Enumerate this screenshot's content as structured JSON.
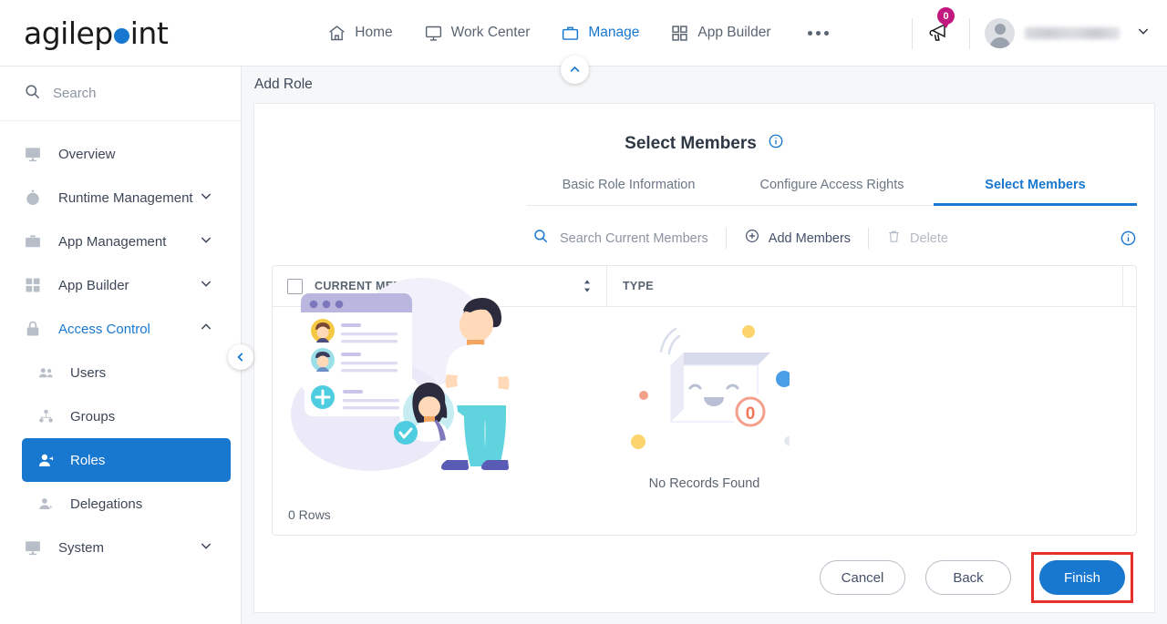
{
  "brand": {
    "name_start": "agilep",
    "name_end": "int",
    "dot_color": "#1878d0"
  },
  "topnav": {
    "items": [
      {
        "label": "Home",
        "icon": "home-icon",
        "active": false
      },
      {
        "label": "Work Center",
        "icon": "monitor-icon",
        "active": false
      },
      {
        "label": "Manage",
        "icon": "briefcase-icon",
        "active": true
      },
      {
        "label": "App Builder",
        "icon": "grid-icon",
        "active": false
      }
    ],
    "more_label": "more-options",
    "notification_count": "0",
    "user_name": ""
  },
  "sidebar": {
    "search_placeholder": "Search",
    "items": [
      {
        "label": "Overview",
        "icon": "chart-monitor-icon",
        "expandable": false,
        "active": false
      },
      {
        "label": "Runtime Management",
        "icon": "stopwatch-icon",
        "expandable": true,
        "active": false
      },
      {
        "label": "App Management",
        "icon": "briefcase-icon",
        "expandable": true,
        "active": false
      },
      {
        "label": "App Builder",
        "icon": "grid-check-icon",
        "expandable": true,
        "active": false
      },
      {
        "label": "Access Control",
        "icon": "lock-icon",
        "expandable": true,
        "active": true,
        "expanded": true
      },
      {
        "label": "System",
        "icon": "system-icon",
        "expandable": true,
        "active": false
      }
    ],
    "subitems": [
      {
        "label": "Users",
        "icon": "users-icon",
        "active": false
      },
      {
        "label": "Groups",
        "icon": "groups-icon",
        "active": false
      },
      {
        "label": "Roles",
        "icon": "role-user-icon",
        "active": true
      },
      {
        "label": "Delegations",
        "icon": "delegation-icon",
        "active": false
      }
    ]
  },
  "page": {
    "title": "Add Role",
    "panel_title": "Select Members",
    "tabs": [
      {
        "label": "Basic Role Information",
        "active": false
      },
      {
        "label": "Configure Access Rights",
        "active": false
      },
      {
        "label": "Select Members",
        "active": true
      }
    ]
  },
  "toolbar": {
    "search_placeholder": "Search Current Members",
    "add_label": "Add Members",
    "delete_label": "Delete"
  },
  "grid": {
    "columns": [
      "CURRENT MEMBER",
      "TYPE"
    ],
    "rows": [],
    "empty_text": "No Records Found",
    "empty_badge": "0",
    "row_count_label": "0 Rows"
  },
  "footer": {
    "cancel_label": "Cancel",
    "back_label": "Back",
    "finish_label": "Finish"
  },
  "colors": {
    "accent": "#1878d0",
    "badge": "#c2177f",
    "highlight": "#e8302a",
    "text": "#3d4757",
    "muted": "#8b94a1"
  }
}
